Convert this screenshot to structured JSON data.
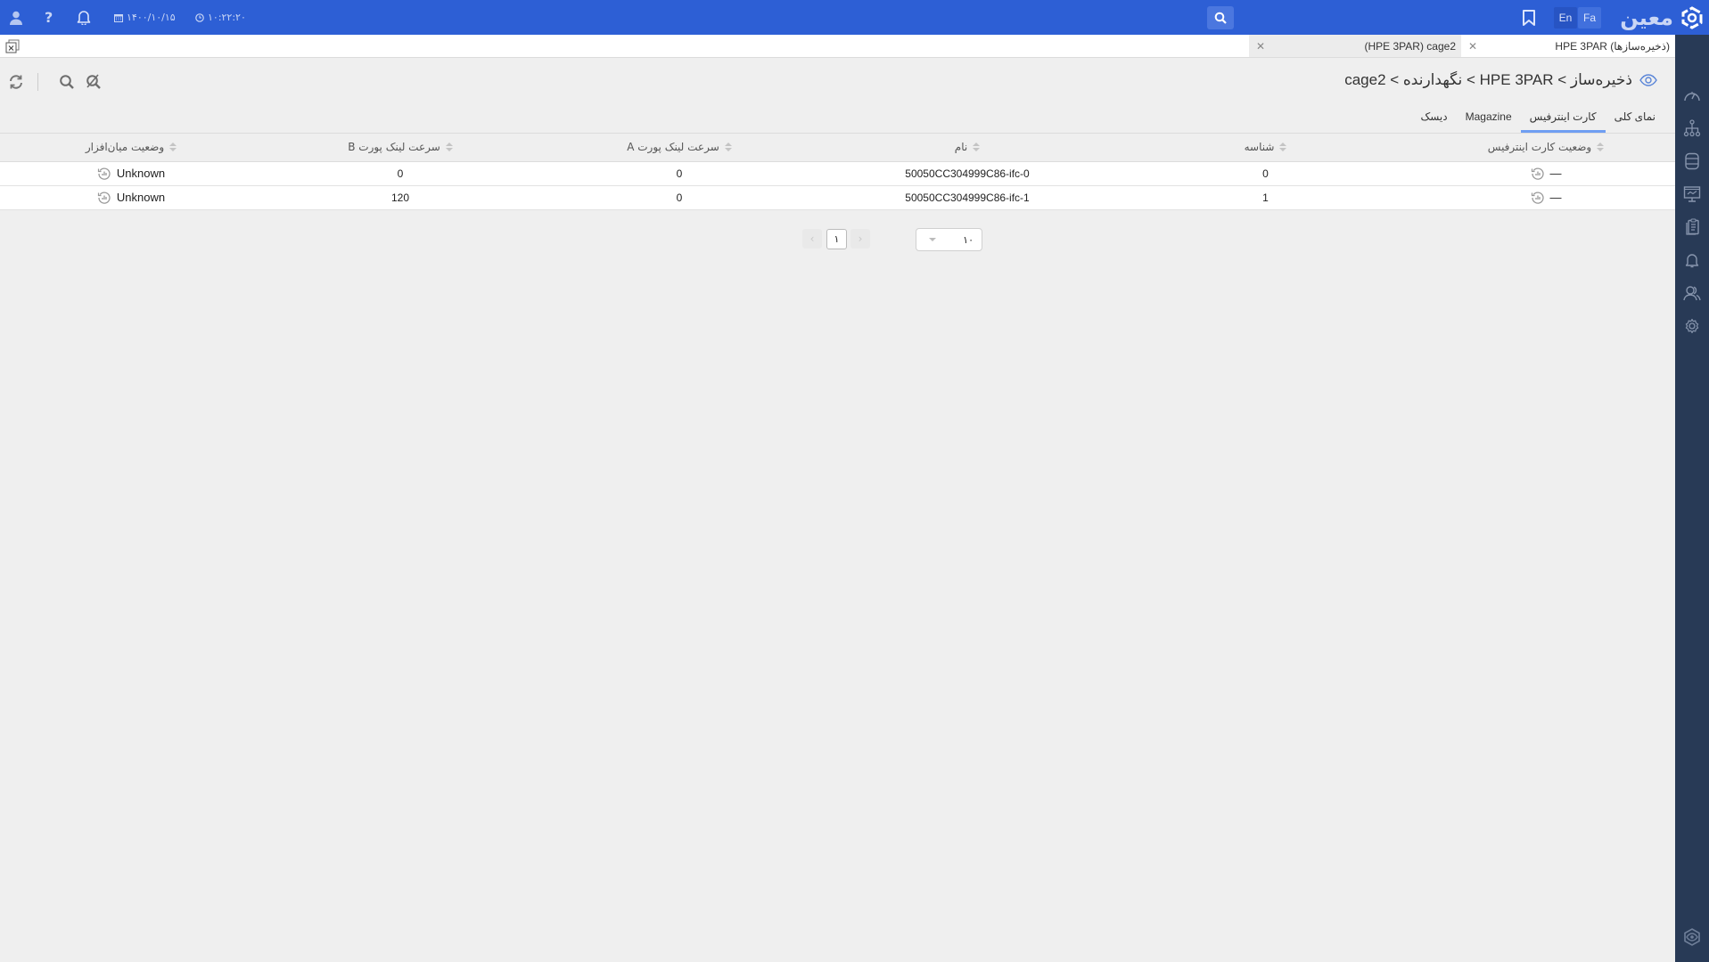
{
  "header": {
    "logo_text": "معین",
    "lang_en": "En",
    "lang_fa": "Fa",
    "date": "۱۴۰۰/۱۰/۱۵",
    "time": "۱۰:۲۲:۲۰",
    "icons": [
      "logo-icon",
      "search-icon",
      "bookmark-icon",
      "bell-icon",
      "help-icon",
      "user-icon",
      "calendar-icon",
      "clock-icon"
    ]
  },
  "doc_tabs": [
    {
      "label": "HPE 3PAR (ذخیره‌سازها)",
      "active": false
    },
    {
      "label": "(HPE 3PAR) cage2",
      "active": true
    }
  ],
  "page": {
    "breadcrumb": "ذخیره‌ساز > HPE 3PAR > نگهدارنده > cage2"
  },
  "view_tabs": [
    {
      "label": "نمای کلی",
      "active": false
    },
    {
      "label": "کارت اینترفیس",
      "active": true
    },
    {
      "label": "Magazine",
      "active": false
    },
    {
      "label": "دیسک",
      "active": false
    }
  ],
  "table": {
    "columns": [
      "وضعیت کارت اینترفیس",
      "شناسه",
      "نام",
      "سرعت لینک پورت A",
      "سرعت لینک پورت B",
      "وضعیت میان‌افزار"
    ],
    "rows": [
      {
        "status": "—",
        "id": "0",
        "name": "50050CC304999C86-ifc-0",
        "port_a": "0",
        "port_b": "0",
        "firmware": "Unknown"
      },
      {
        "status": "—",
        "id": "1",
        "name": "50050CC304999C86-ifc-1",
        "port_a": "0",
        "port_b": "120",
        "firmware": "Unknown"
      }
    ]
  },
  "pagination": {
    "current_page": "۱",
    "page_size": "۱۰"
  },
  "sidebar": {
    "items": [
      "dashboard-icon",
      "topology-icon",
      "storage-icon",
      "monitor-icon",
      "reports-icon",
      "alerts-icon",
      "users-icon",
      "settings-icon"
    ],
    "footer": "brand-eye-icon"
  }
}
